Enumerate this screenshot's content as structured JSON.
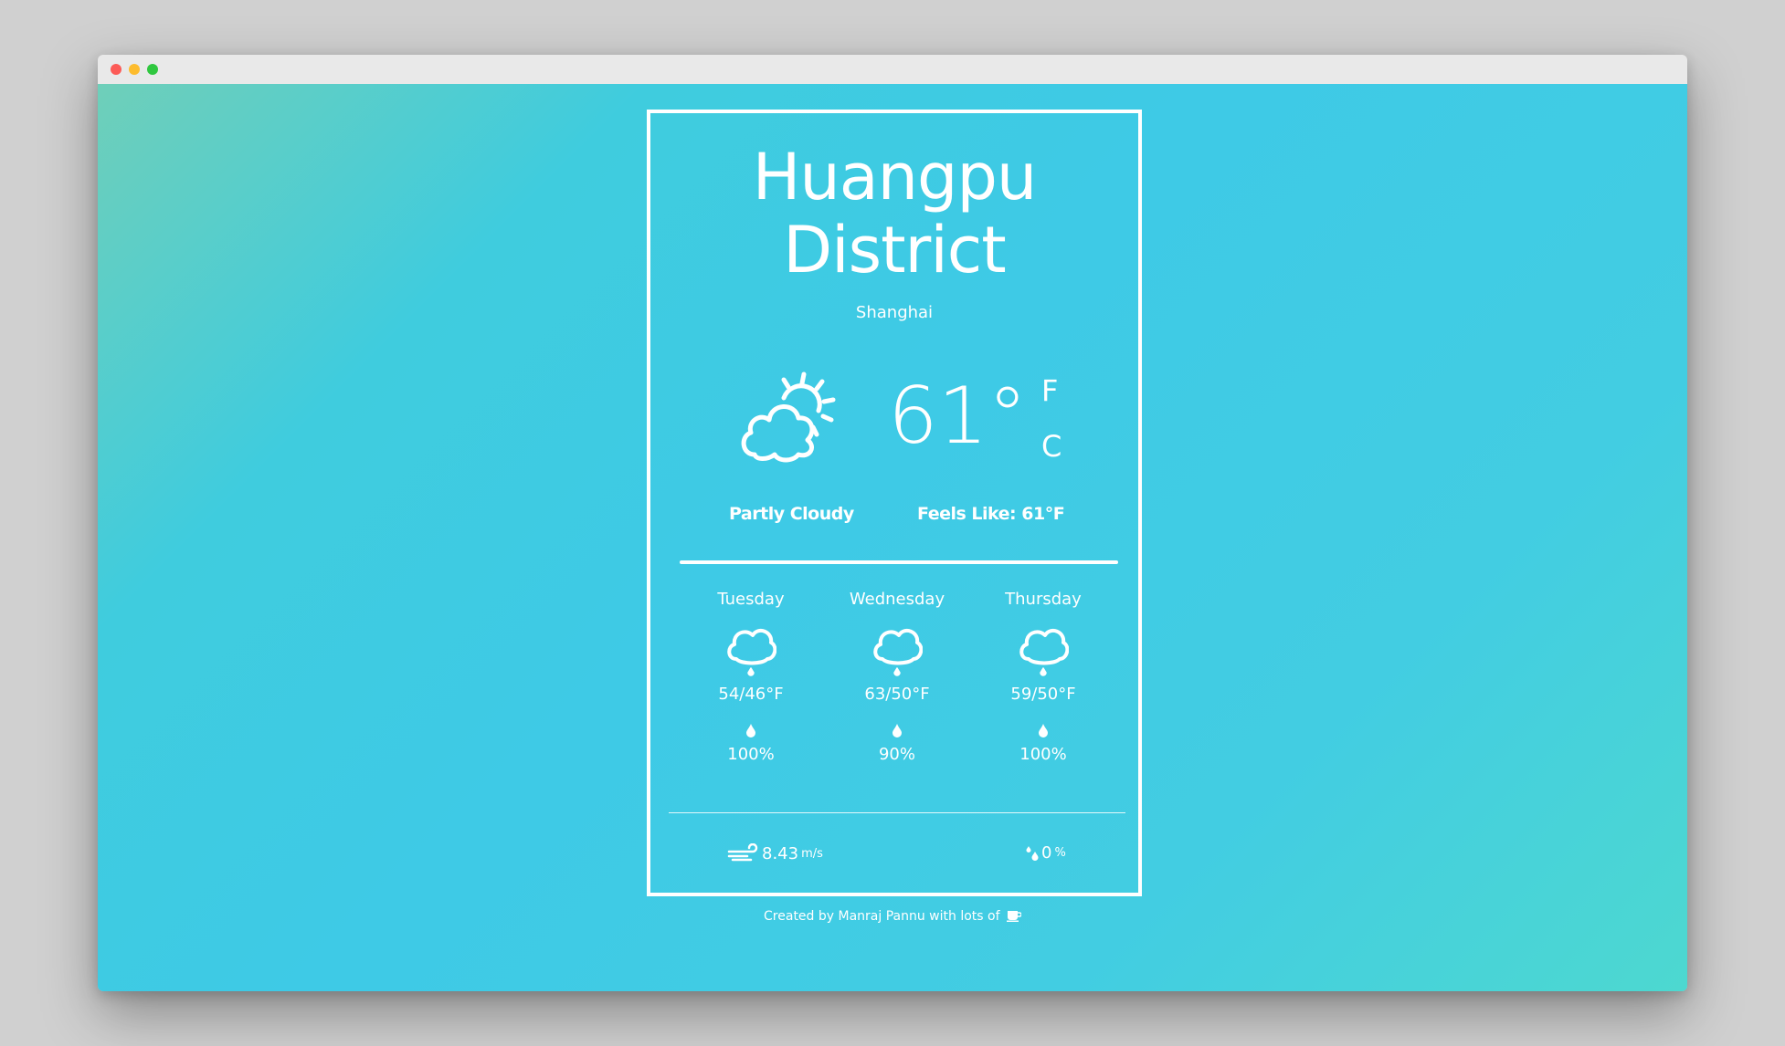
{
  "location": {
    "city": "Huangpu District",
    "region": "Shanghai"
  },
  "current": {
    "icon": "partly-cloudy-icon",
    "temperature": "61°",
    "unit_f": "F",
    "unit_c": "C",
    "condition": "Partly Cloudy",
    "feels_like": "Feels Like: 61°F"
  },
  "forecast": [
    {
      "day": "Tuesday",
      "icon": "rain-cloud-icon",
      "temp": "54/46°F",
      "precip": "100%"
    },
    {
      "day": "Wednesday",
      "icon": "rain-cloud-icon",
      "temp": "63/50°F",
      "precip": "90%"
    },
    {
      "day": "Thursday",
      "icon": "rain-cloud-icon",
      "temp": "59/50°F",
      "precip": "100%"
    }
  ],
  "details": {
    "wind_value": "8.43",
    "wind_unit": "m/s",
    "humidity_value": "0",
    "humidity_unit": "%"
  },
  "footer": {
    "text": "Created by Manraj Pannu with lots of"
  },
  "colors": {
    "gradient_start": "#6fcfb9",
    "gradient_mid": "#3ecae6",
    "gradient_end": "#4dd8d0",
    "foreground": "#ffffff"
  }
}
